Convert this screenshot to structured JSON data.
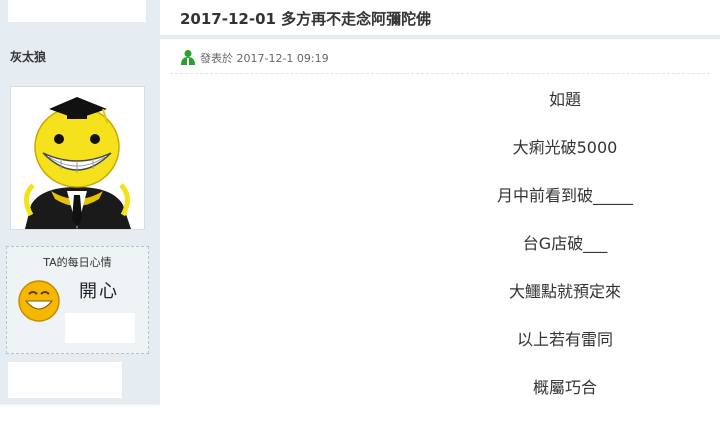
{
  "sidebar": {
    "username": "灰太狼",
    "mood": {
      "title": "TA的每日心情",
      "text": "開心",
      "icon": "grinning-face-icon"
    }
  },
  "thread": {
    "title": "2017-12-01 多方再不走念阿彌陀佛",
    "posted_label": "發表於 2017-12-1 09:19",
    "status_icon": "online-user-icon"
  },
  "post": {
    "lines": [
      "如題",
      "大痢光破5000",
      "月中前看到破_____",
      "台G店破___",
      "大鱷點就預定來",
      "以上若有雷同",
      "概屬巧合"
    ]
  },
  "colors": {
    "sidebar_bg": "#e5edf2",
    "title_text": "#333333",
    "online_icon": "#2e9e2e"
  }
}
